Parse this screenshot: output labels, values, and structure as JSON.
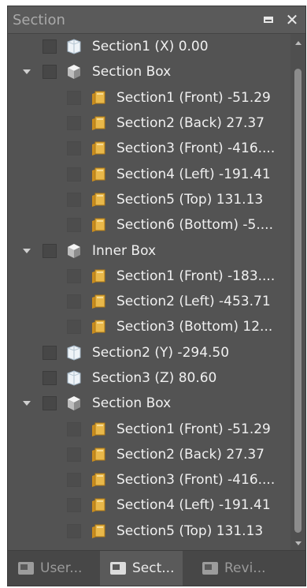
{
  "panel": {
    "title": "Section",
    "restore_label": "",
    "close_label": "✕"
  },
  "tree": [
    {
      "level": 0,
      "expander": false,
      "checked": false,
      "icon": "section-plane-icon",
      "label": "Section1 (X) 0.00"
    },
    {
      "level": 0,
      "expander": true,
      "checked": false,
      "icon": "box-icon",
      "label": "Section Box"
    },
    {
      "level": 1,
      "expander": false,
      "checked": false,
      "icon": "folder-icon",
      "label": "Section1 (Front) -51.29"
    },
    {
      "level": 1,
      "expander": false,
      "checked": false,
      "icon": "folder-icon",
      "label": "Section2 (Back) 27.37"
    },
    {
      "level": 1,
      "expander": false,
      "checked": false,
      "icon": "folder-icon",
      "label": "Section3 (Front) -416...."
    },
    {
      "level": 1,
      "expander": false,
      "checked": false,
      "icon": "folder-icon",
      "label": "Section4 (Left) -191.41"
    },
    {
      "level": 1,
      "expander": false,
      "checked": false,
      "icon": "folder-icon",
      "label": "Section5 (Top) 131.13"
    },
    {
      "level": 1,
      "expander": false,
      "checked": false,
      "icon": "folder-icon",
      "label": "Section6 (Bottom) -5...."
    },
    {
      "level": 0,
      "expander": true,
      "checked": false,
      "icon": "box-icon",
      "label": "Inner Box"
    },
    {
      "level": 1,
      "expander": false,
      "checked": false,
      "icon": "folder-icon",
      "label": "Section1 (Front) -183...."
    },
    {
      "level": 1,
      "expander": false,
      "checked": false,
      "icon": "folder-icon",
      "label": "Section2 (Left) -453.71"
    },
    {
      "level": 1,
      "expander": false,
      "checked": false,
      "icon": "folder-icon",
      "label": "Section3 (Bottom) 12..."
    },
    {
      "level": 0,
      "expander": false,
      "checked": false,
      "icon": "section-plane-icon",
      "label": "Section2 (Y) -294.50"
    },
    {
      "level": 0,
      "expander": false,
      "checked": false,
      "icon": "section-plane-icon",
      "label": "Section3 (Z) 80.60"
    },
    {
      "level": 0,
      "expander": true,
      "checked": false,
      "icon": "box-icon",
      "label": "Section Box"
    },
    {
      "level": 1,
      "expander": false,
      "checked": false,
      "icon": "folder-icon",
      "label": "Section1 (Front) -51.29"
    },
    {
      "level": 1,
      "expander": false,
      "checked": false,
      "icon": "folder-icon",
      "label": "Section2 (Back) 27.37"
    },
    {
      "level": 1,
      "expander": false,
      "checked": false,
      "icon": "folder-icon",
      "label": "Section3 (Front) -416...."
    },
    {
      "level": 1,
      "expander": false,
      "checked": false,
      "icon": "folder-icon",
      "label": "Section4 (Left) -191.41"
    },
    {
      "level": 1,
      "expander": false,
      "checked": false,
      "icon": "folder-icon",
      "label": "Section5 (Top) 131.13"
    }
  ],
  "tabs": [
    {
      "label": "User...",
      "icon": "user-tab-icon",
      "active": false
    },
    {
      "label": "Sect...",
      "icon": "section-tab-icon",
      "active": true
    },
    {
      "label": "Revi...",
      "icon": "review-tab-icon",
      "active": false
    }
  ],
  "colors": {
    "panel_bg": "#535353",
    "text": "#f0f0f0",
    "folder": "#e9b84a",
    "plane": "#c9d9e6"
  }
}
